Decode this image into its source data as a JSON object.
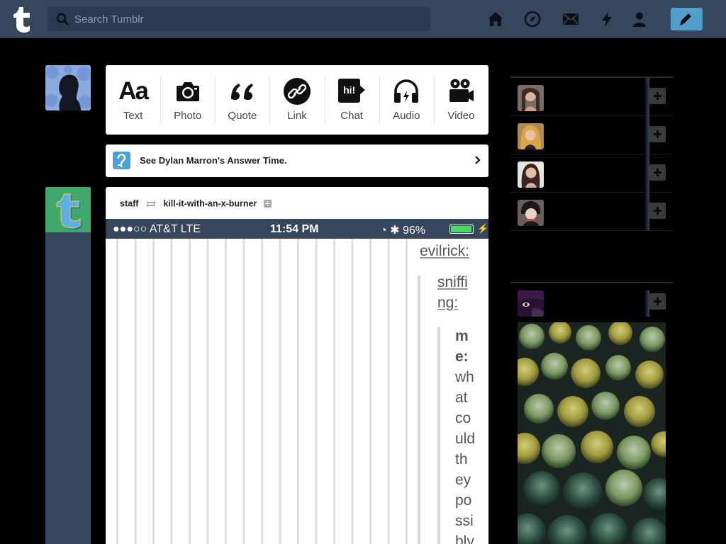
{
  "header": {
    "search_placeholder": "Search Tumblr",
    "icons": [
      "home-icon",
      "explore-icon",
      "messages-icon",
      "activity-icon",
      "account-icon"
    ],
    "compose_icon": "pencil-icon",
    "colors": {
      "bar": "#36465d",
      "compose": "#529ecc"
    }
  },
  "post_types": [
    {
      "label": "Text",
      "icon": "text-icon",
      "glyph": "Aa"
    },
    {
      "label": "Photo",
      "icon": "camera-icon"
    },
    {
      "label": "Quote",
      "icon": "quote-icon"
    },
    {
      "label": "Link",
      "icon": "link-icon"
    },
    {
      "label": "Chat",
      "icon": "chat-icon",
      "glyph": "hi!"
    },
    {
      "label": "Audio",
      "icon": "headphones-icon"
    },
    {
      "label": "Video",
      "icon": "video-camera-icon"
    }
  ],
  "banner": {
    "icon": "answer-time-icon",
    "text": "See Dylan Marron's Answer Time."
  },
  "post": {
    "author": "staff",
    "reblogged_from": "kill-it-with-an-x-burner",
    "image": {
      "status_left": "●●●○○ AT&T  LTE",
      "time": "11:54 PM",
      "status_right": "◔ ✱ 96%",
      "lines": [
        {
          "text": "evilrick:",
          "underline": true
        },
        {
          "text": "sniffi",
          "underline": true
        },
        {
          "text": "ng:",
          "underline": true
        }
      ],
      "words": [
        "m",
        "e:",
        "wh",
        "at",
        "co",
        "uld",
        "th",
        "ey",
        "po",
        "ssi",
        "bly"
      ]
    }
  },
  "recommended_blogs": [
    {
      "avatar": "avatar-1",
      "color": "#7a6a66"
    },
    {
      "avatar": "avatar-2",
      "color": "#b08a54"
    },
    {
      "avatar": "avatar-3",
      "color": "#8a7068"
    },
    {
      "avatar": "avatar-4",
      "color": "#6a5e5a"
    }
  ],
  "radar": {
    "avatar_color": "#2b1036",
    "image": "cactus-photo"
  }
}
